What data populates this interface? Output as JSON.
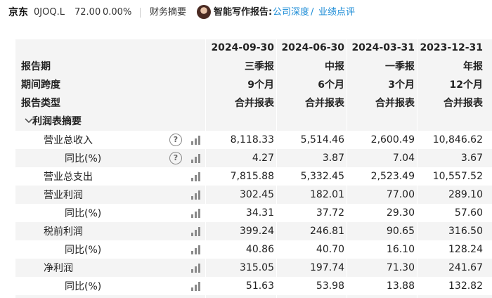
{
  "topbar": {
    "company": "京东",
    "code": "0JOQ.L",
    "price": "72.00",
    "change": "0.00%",
    "tab": "财务摘要",
    "report_label": "智能写作报告:",
    "link_company": "公司深度",
    "link_sep": "/",
    "link_earnings": "业绩点评",
    "avatar_icon": "portrait-avatar"
  },
  "table": {
    "columns": [
      {
        "date": "2024-09-30",
        "period": "三季报",
        "span": "9个月",
        "type": "合并报表"
      },
      {
        "date": "2024-06-30",
        "period": "中报",
        "span": "6个月",
        "type": "合并报表"
      },
      {
        "date": "2024-03-31",
        "period": "一季报",
        "span": "3个月",
        "type": "合并报表"
      },
      {
        "date": "2023-12-31",
        "period": "年报",
        "span": "12个月",
        "type": "合并报表"
      }
    ],
    "header_labels": {
      "report_period": "报告期",
      "period_span": "期间跨度",
      "report_type": "报告类型"
    },
    "section_title": "利润表摘要",
    "rows": [
      {
        "label": "营业总收入",
        "values": [
          "8,118.33",
          "5,514.46",
          "2,600.49",
          "10,846.62"
        ]
      },
      {
        "label": "同比(%)",
        "values": [
          "4.27",
          "3.87",
          "7.04",
          "3.67"
        ]
      },
      {
        "label": "营业总支出",
        "values": [
          "7,815.88",
          "5,332.45",
          "2,523.49",
          "10,557.52"
        ]
      },
      {
        "label": "营业利润",
        "values": [
          "302.45",
          "182.01",
          "77.00",
          "289.10"
        ]
      },
      {
        "label": "同比(%)",
        "values": [
          "34.31",
          "37.72",
          "29.30",
          "57.60"
        ]
      },
      {
        "label": "税前利润",
        "values": [
          "399.24",
          "246.81",
          "90.65",
          "316.50"
        ]
      },
      {
        "label": "同比(%)",
        "values": [
          "40.86",
          "40.70",
          "16.10",
          "128.24"
        ]
      },
      {
        "label": "净利润",
        "values": [
          "315.05",
          "197.74",
          "71.30",
          "241.67"
        ]
      },
      {
        "label": "同比(%)",
        "values": [
          "51.63",
          "53.98",
          "13.88",
          "132.82"
        ]
      }
    ],
    "help_icon_text": "?",
    "colors": {
      "link": "#1a8bd6",
      "panel": "#f4f4f4"
    }
  }
}
